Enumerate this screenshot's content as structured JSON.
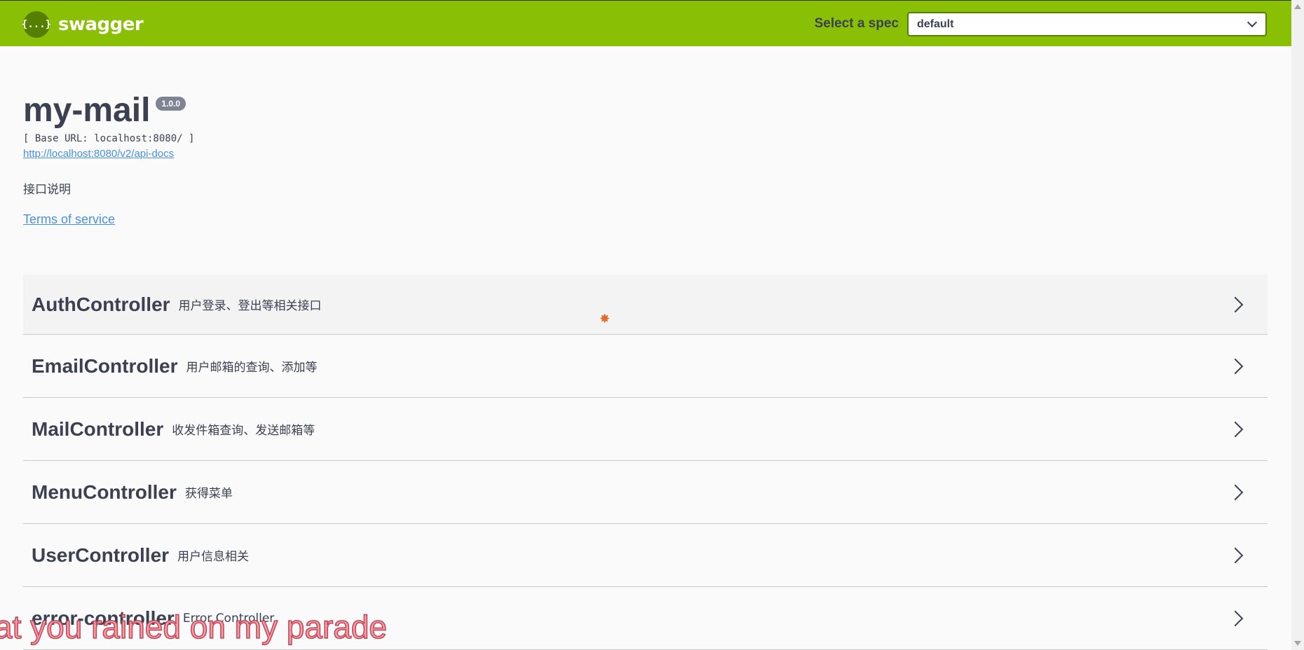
{
  "topbar": {
    "brand_logo": "{...}",
    "brand_name": "swagger",
    "spec_label": "Select a spec",
    "spec_selected": "default"
  },
  "info": {
    "title": "my-mail",
    "version": "1.0.0",
    "base_url": "[ Base URL: localhost:8080/ ]",
    "api_docs_url": "http://localhost:8080/v2/api-docs",
    "description": "接口说明",
    "terms_of_service": "Terms of service"
  },
  "controllers": [
    {
      "name": "AuthController",
      "description": "用户登录、登出等相关接口"
    },
    {
      "name": "EmailController",
      "description": "用户邮箱的查询、添加等"
    },
    {
      "name": "MailController",
      "description": "收发件箱查询、发送邮箱等"
    },
    {
      "name": "MenuController",
      "description": "获得菜单"
    },
    {
      "name": "UserController",
      "description": "用户信息相关"
    },
    {
      "name": "error-controller",
      "description": "Error Controller"
    }
  ],
  "overlay_caption": "at you rained on my parade",
  "icons": {
    "brand": "swagger-logo-icon",
    "dropdown": "chevron-down-icon",
    "expand": "chevron-right-icon",
    "cursor": "cursor-sprite-icon"
  },
  "colors": {
    "topbar": "#89bf04",
    "link": "#4990e2",
    "text": "#3b4151",
    "badge": "#7d8492"
  }
}
